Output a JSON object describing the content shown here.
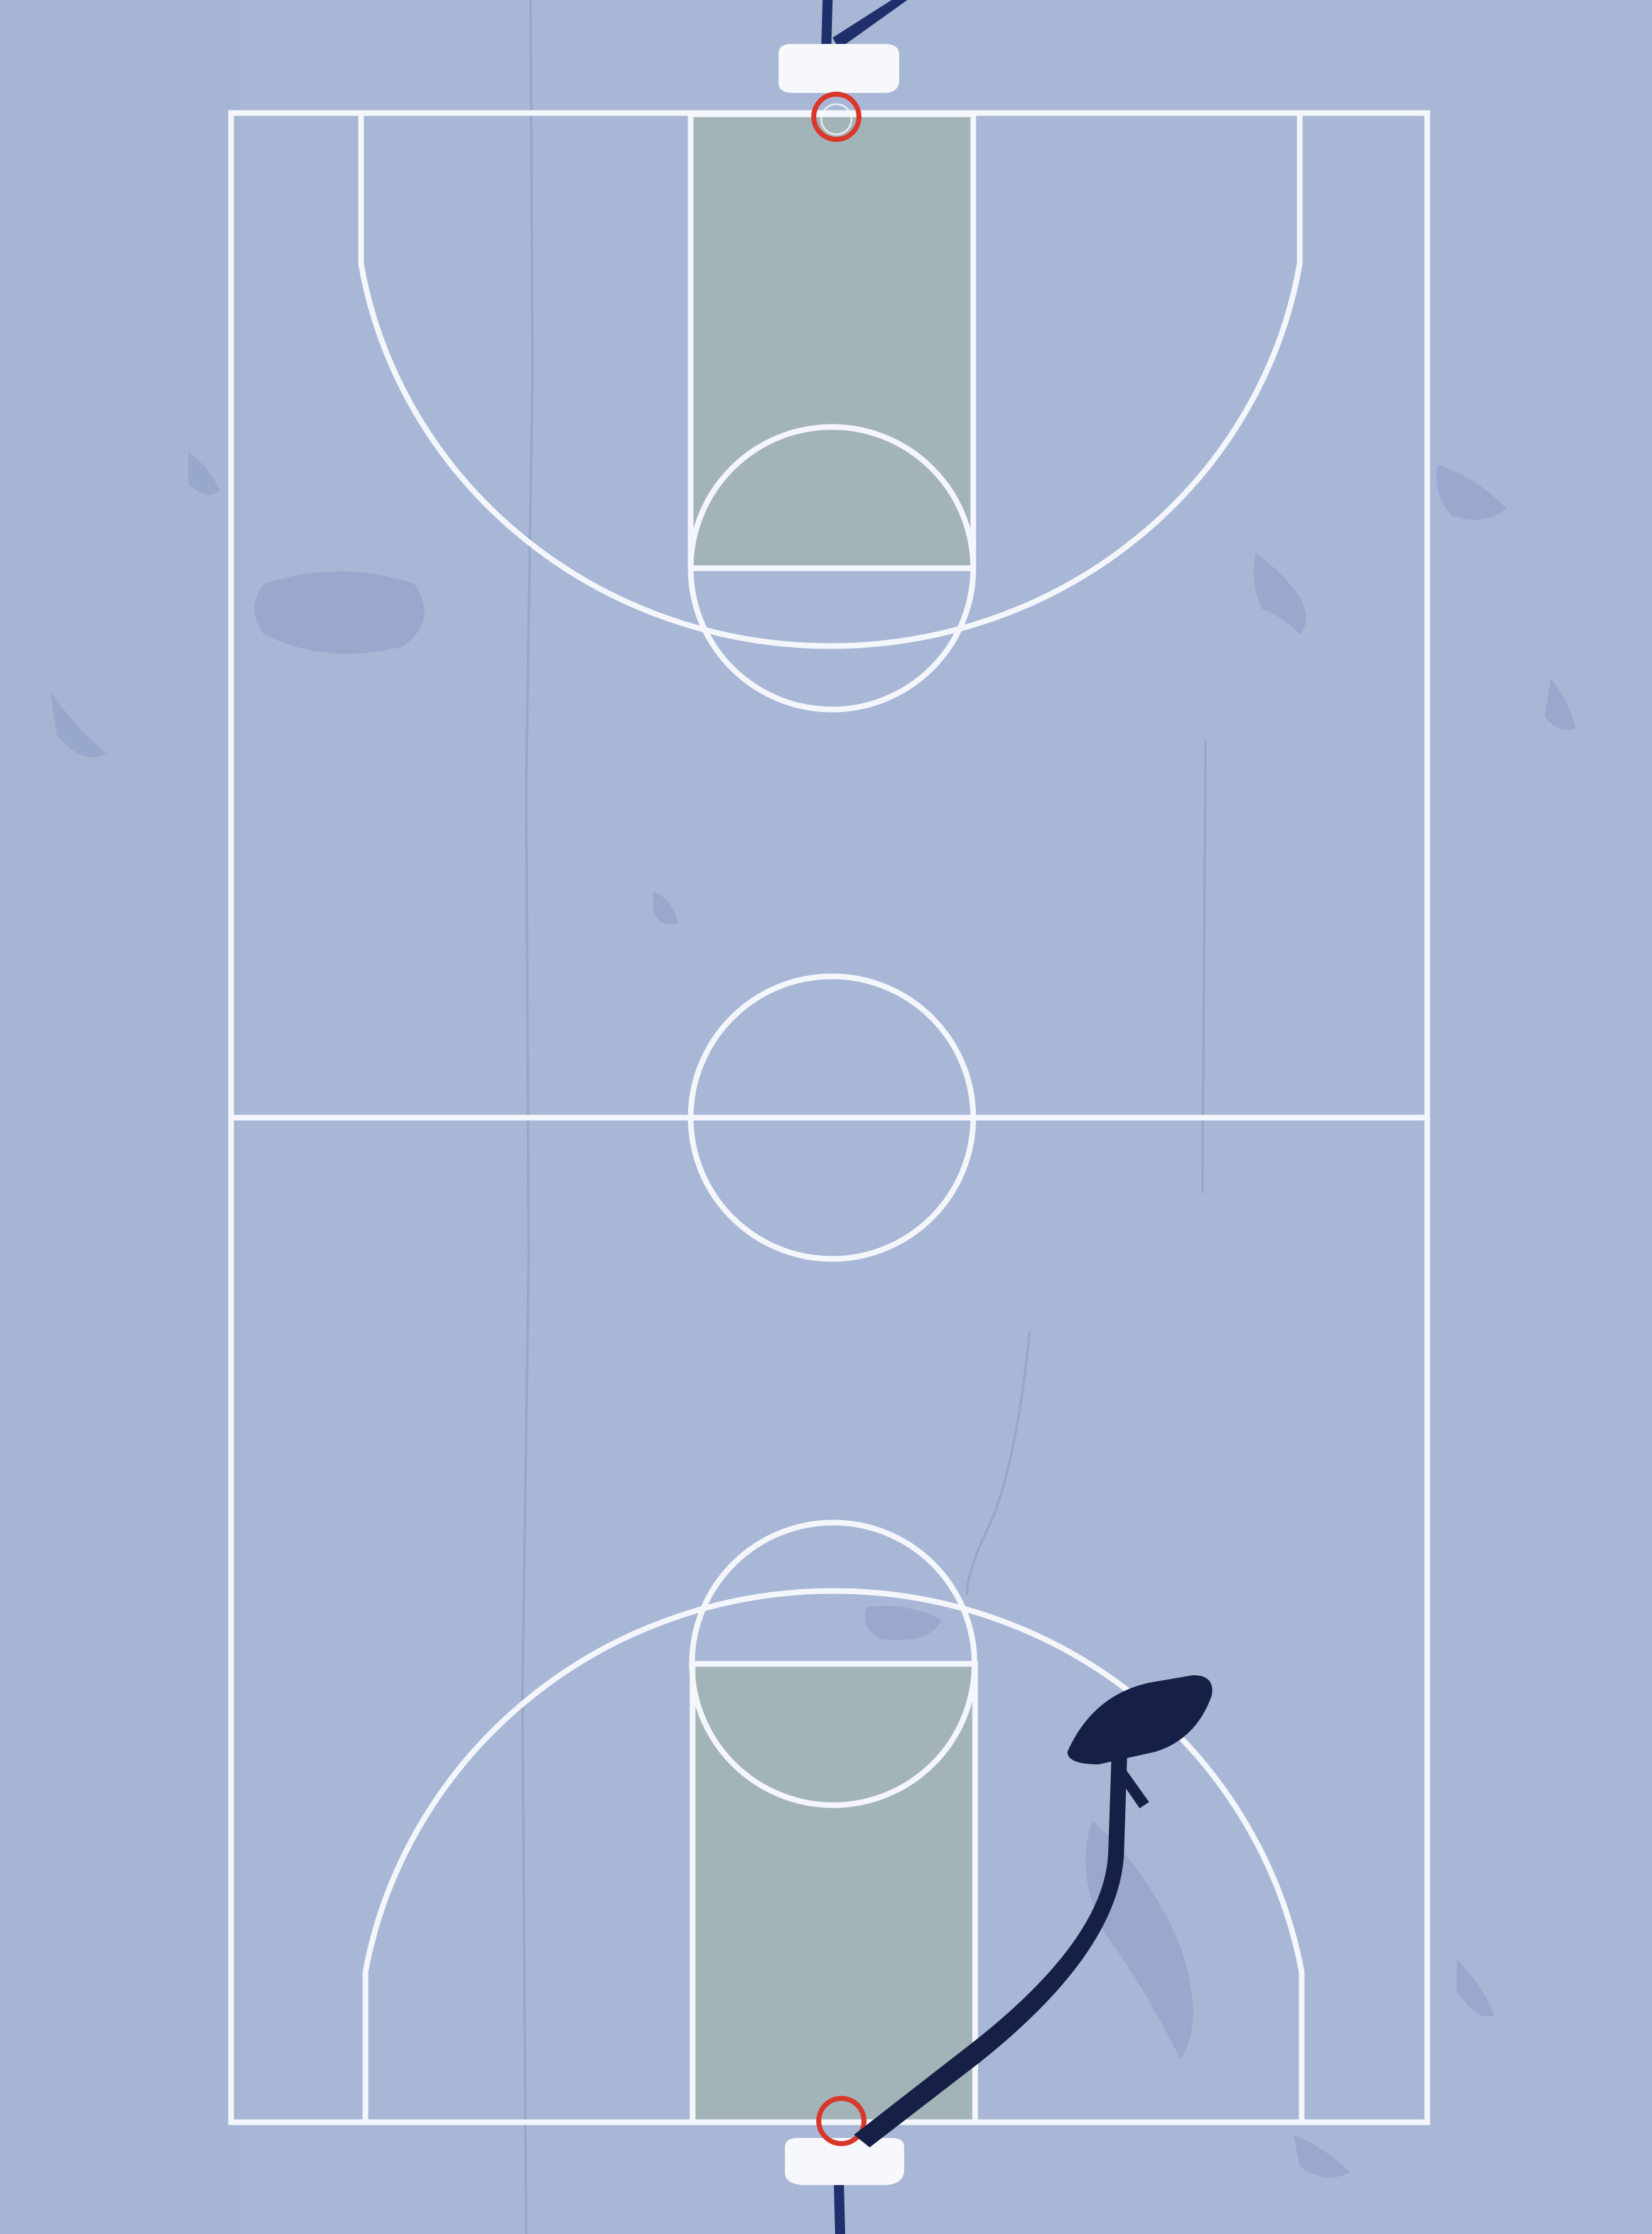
{
  "scene": {
    "subject": "aerial-view-basketball-court",
    "colors": {
      "surface": "#a9b7d6",
      "surface_shade": "#9fb0d1",
      "court_lines": "#f4f6fb",
      "paint_area": "#a3b4b8",
      "backboard": "#f7f8fb",
      "hoop_rim": "#d9372a",
      "pole": "#1f2f6b",
      "shadow": "#162046",
      "crack": "#8e9cbc",
      "stain": "#8d9dc4"
    },
    "icons": [
      "backboard-icon",
      "hoop-icon",
      "pole-icon"
    ]
  }
}
